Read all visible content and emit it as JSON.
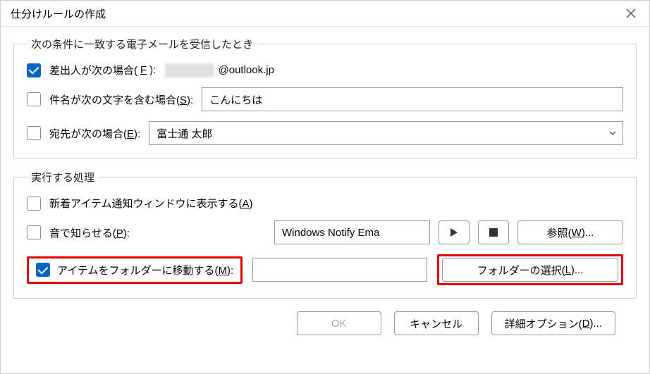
{
  "window": {
    "title": "仕分けルールの作成",
    "close_icon": "close-icon"
  },
  "conditions": {
    "legend": "次の条件に一致する電子メールを受信したとき",
    "from": {
      "checked": true,
      "label_pre": "差出人が次の場合(",
      "hotkey": "F",
      "label_post": "):",
      "email_domain": "@outlook.jp"
    },
    "subject": {
      "checked": false,
      "label_pre": "件名が次の文字を含む場合(",
      "hotkey": "S",
      "label_post": "):",
      "value": "こんにちは"
    },
    "to": {
      "checked": false,
      "label_pre": "宛先が次の場合(",
      "hotkey": "E",
      "label_post": "):",
      "value": "富士通 太郎"
    }
  },
  "actions": {
    "legend": "実行する処理",
    "alert": {
      "checked": false,
      "label_pre": "新着アイテム通知ウィンドウに表示する(",
      "hotkey": "A",
      "label_post": ")"
    },
    "sound": {
      "checked": false,
      "label_pre": "音で知らせる(",
      "hotkey": "P",
      "label_post": "):",
      "value": "Windows Notify Ema",
      "browse_pre": "参照(",
      "browse_hotkey": "W",
      "browse_post": ")..."
    },
    "move": {
      "checked": true,
      "label_pre": "アイテムをフォルダーに移動する(",
      "hotkey": "M",
      "label_post": "):",
      "folder_value": "",
      "select_pre": "フォルダーの選択(",
      "select_hotkey": "L",
      "select_post": ")..."
    }
  },
  "footer": {
    "ok": "OK",
    "cancel": "キャンセル",
    "advanced_pre": "詳細オプション(",
    "advanced_hotkey": "D",
    "advanced_post": ")..."
  }
}
